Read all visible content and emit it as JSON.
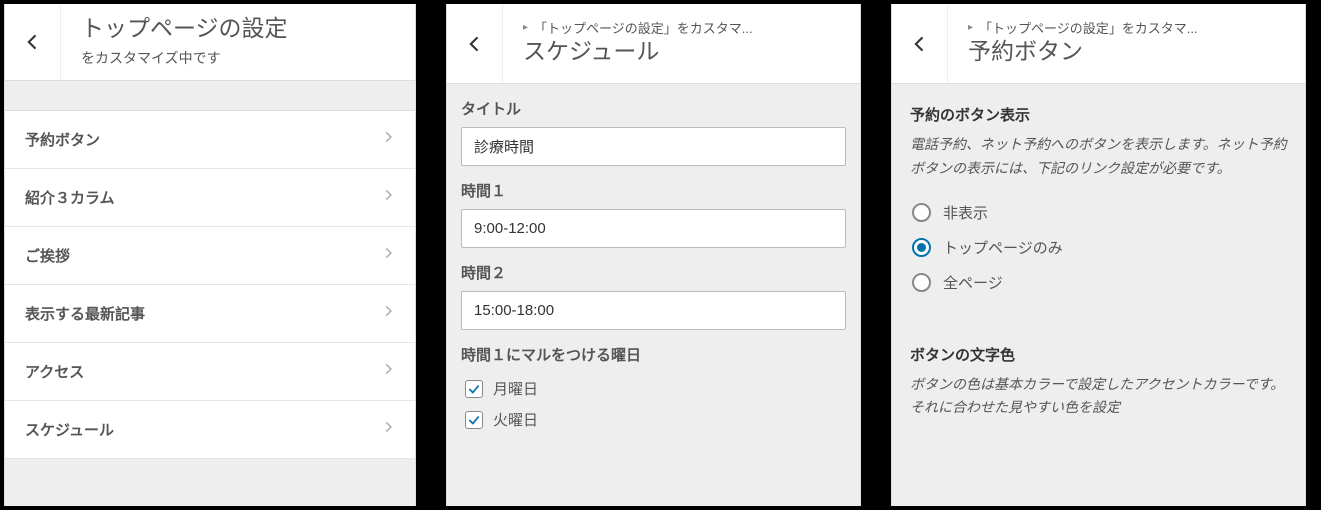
{
  "panel1": {
    "title": "トップページの設定",
    "subtitle": "をカスタマイズ中です",
    "items": [
      {
        "label": "予約ボタン"
      },
      {
        "label": "紹介３カラム"
      },
      {
        "label": "ご挨拶"
      },
      {
        "label": "表示する最新記事"
      },
      {
        "label": "アクセス"
      },
      {
        "label": "スケジュール"
      }
    ]
  },
  "panel2": {
    "breadcrumb": "「トップページの設定」をカスタマ...",
    "title": "スケジュール",
    "fields": {
      "title_label": "タイトル",
      "title_value": "診療時間",
      "time1_label": "時間１",
      "time1_value": "9:00-12:00",
      "time2_label": "時間２",
      "time2_value": "15:00-18:00",
      "days_label": "時間１にマルをつける曜日",
      "days": [
        {
          "label": "月曜日",
          "checked": true
        },
        {
          "label": "火曜日",
          "checked": true
        }
      ]
    }
  },
  "panel3": {
    "breadcrumb": "「トップページの設定」をカスタマ...",
    "title": "予約ボタン",
    "section1": {
      "heading": "予約のボタン表示",
      "desc": "電話予約、ネット予約へのボタンを表示します。ネット予約ボタンの表示には、下記のリンク設定が必要です。",
      "options": [
        {
          "label": "非表示",
          "checked": false
        },
        {
          "label": "トップページのみ",
          "checked": true
        },
        {
          "label": "全ページ",
          "checked": false
        }
      ]
    },
    "section2": {
      "heading": "ボタンの文字色",
      "desc": "ボタンの色は基本カラーで設定したアクセントカラーです。それに合わせた見やすい色を設定"
    }
  }
}
